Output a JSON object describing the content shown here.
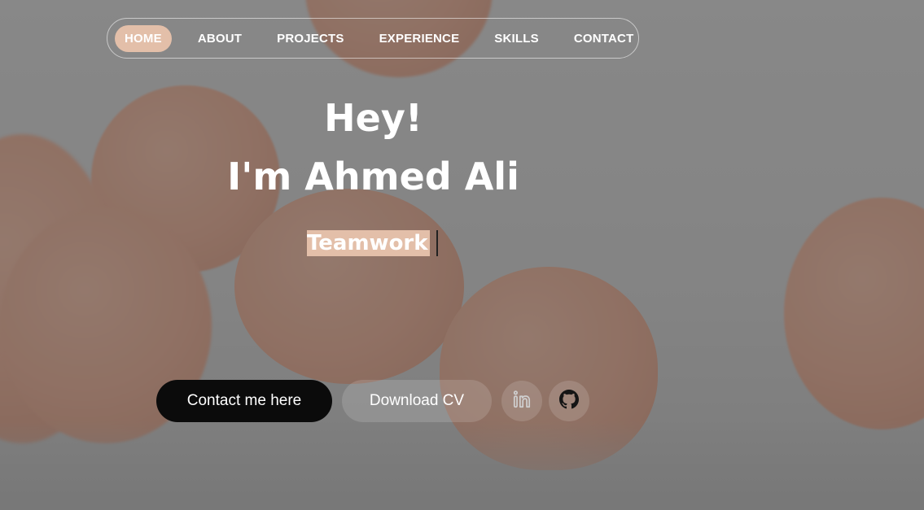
{
  "nav": {
    "items": [
      {
        "label": "HOME",
        "active": true
      },
      {
        "label": "ABOUT",
        "active": false
      },
      {
        "label": "PROJECTS",
        "active": false
      },
      {
        "label": "EXPERIENCE",
        "active": false
      },
      {
        "label": "SKILLS",
        "active": false
      },
      {
        "label": "CONTACT",
        "active": false
      }
    ]
  },
  "hero": {
    "greeting": "Hey!",
    "name": "I'm Ahmed Ali",
    "typed_word": "Teamwork"
  },
  "actions": {
    "contact_label": "Contact me here",
    "cv_label": "Download CV"
  },
  "social": {
    "linkedin_icon": "linkedin-icon",
    "github_icon": "github-icon"
  },
  "colors": {
    "accent": "#e3bfa9",
    "primary_button": "#0b0b0b",
    "text": "#ffffff"
  }
}
